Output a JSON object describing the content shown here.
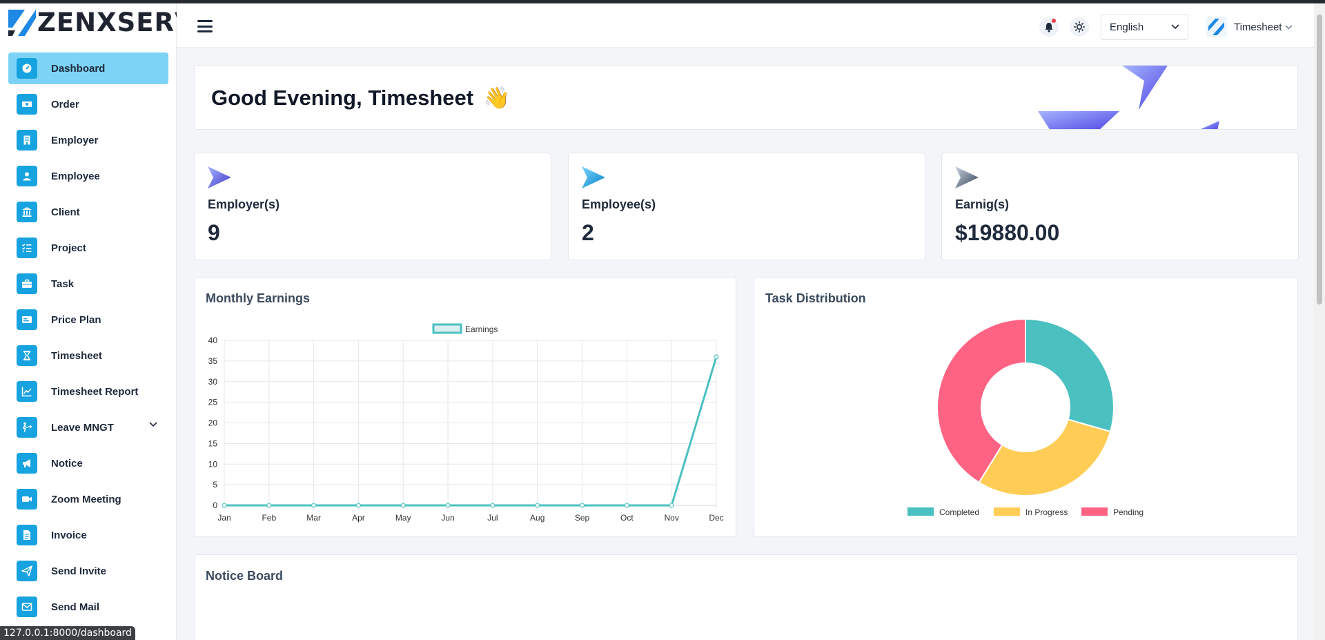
{
  "brand": {
    "name": "ZENXSERV"
  },
  "sidebar": {
    "items": [
      {
        "label": "Dashboard",
        "icon": "dashboard-gauge-icon"
      },
      {
        "label": "Order",
        "icon": "money-bill-icon"
      },
      {
        "label": "Employer",
        "icon": "building-icon"
      },
      {
        "label": "Employee",
        "icon": "user-badge-icon"
      },
      {
        "label": "Client",
        "icon": "landmark-icon"
      },
      {
        "label": "Project",
        "icon": "checklist-icon"
      },
      {
        "label": "Task",
        "icon": "briefcase-icon"
      },
      {
        "label": "Price Plan",
        "icon": "price-card-icon"
      },
      {
        "label": "Timesheet",
        "icon": "hourglass-icon"
      },
      {
        "label": "Timesheet Report",
        "icon": "line-chart-icon"
      },
      {
        "label": "Leave MNGT",
        "icon": "person-exit-icon"
      },
      {
        "label": "Notice",
        "icon": "megaphone-icon"
      },
      {
        "label": "Zoom Meeting",
        "icon": "video-camera-icon"
      },
      {
        "label": "Invoice",
        "icon": "file-invoice-icon"
      },
      {
        "label": "Send Invite",
        "icon": "paper-plane-icon"
      },
      {
        "label": "Send Mail",
        "icon": "envelope-icon"
      }
    ]
  },
  "status_url": "127.0.0.1:8000/dashboard",
  "header": {
    "language": "English",
    "user_name": "Timesheet"
  },
  "greeting": {
    "text": "Good Evening, Timesheet",
    "emoji": "👋"
  },
  "stats": [
    {
      "label": "Employer(s)",
      "value": "9",
      "color": "#6366f1"
    },
    {
      "label": "Employee(s)",
      "value": "2",
      "color": "#0ea5e9"
    },
    {
      "label": "Earnig(s)",
      "value": "$19880.00",
      "color": "#64748b"
    }
  ],
  "monthly_earnings": {
    "title": "Monthly Earnings",
    "chart_data": {
      "type": "line",
      "title": "",
      "xlabel": "",
      "ylabel": "",
      "categories": [
        "Jan",
        "Feb",
        "Mar",
        "Apr",
        "May",
        "Jun",
        "Jul",
        "Aug",
        "Sep",
        "Oct",
        "Nov",
        "Dec"
      ],
      "series": [
        {
          "name": "Earnings",
          "values": [
            0,
            0,
            0,
            0,
            0,
            0,
            0,
            0,
            0,
            0,
            0,
            36
          ],
          "color": "#4bc0c0"
        }
      ],
      "ylim": [
        0,
        40
      ],
      "yticks": [
        0,
        5,
        10,
        15,
        20,
        25,
        30,
        35,
        40
      ],
      "grid": true,
      "legend": "top"
    }
  },
  "task_distribution": {
    "title": "Task Distribution",
    "chart_data": {
      "type": "pie",
      "donut": true,
      "labels": [
        "Completed",
        "In Progress",
        "Pending"
      ],
      "values": [
        1,
        1,
        1.4
      ],
      "colors": [
        "#4bc0c0",
        "#ffcd56",
        "#ff6384"
      ],
      "legend": "bottom"
    }
  },
  "notice_board": {
    "title": "Notice Board"
  }
}
